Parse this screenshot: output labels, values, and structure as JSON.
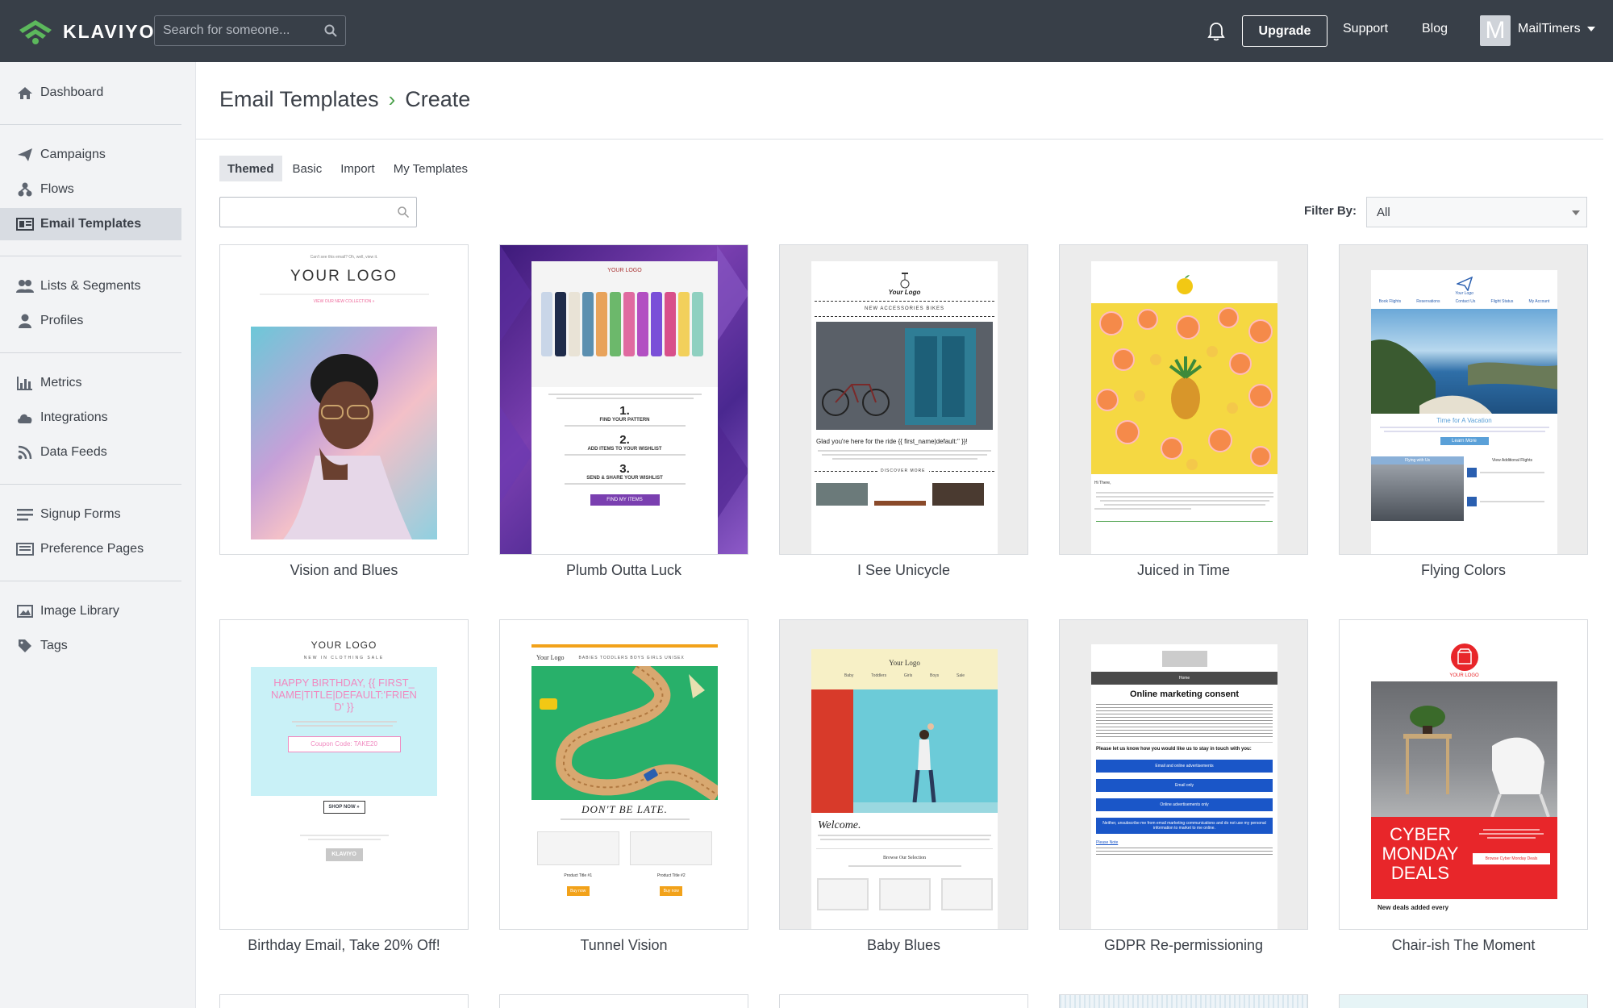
{
  "brand": {
    "name": "KLAVIYO",
    "accent": "#4aa04a",
    "topbar_bg": "#383f48"
  },
  "topbar": {
    "search_placeholder": "Search for someone...",
    "upgrade": "Upgrade",
    "support": "Support",
    "blog": "Blog",
    "avatar_letter": "M",
    "account": "MailTimers"
  },
  "sidebar": {
    "items": [
      {
        "label": "Dashboard",
        "icon": "home-icon"
      },
      {
        "label": "Campaigns",
        "icon": "paper-plane-icon"
      },
      {
        "label": "Flows",
        "icon": "flows-icon"
      },
      {
        "label": "Email Templates",
        "icon": "template-icon",
        "active": true
      },
      {
        "label": "Lists & Segments",
        "icon": "users-icon"
      },
      {
        "label": "Profiles",
        "icon": "user-icon"
      },
      {
        "label": "Metrics",
        "icon": "bar-chart-icon"
      },
      {
        "label": "Integrations",
        "icon": "cloud-icon"
      },
      {
        "label": "Data Feeds",
        "icon": "rss-icon"
      },
      {
        "label": "Signup Forms",
        "icon": "form-icon"
      },
      {
        "label": "Preference Pages",
        "icon": "page-icon"
      },
      {
        "label": "Image Library",
        "icon": "image-icon"
      },
      {
        "label": "Tags",
        "icon": "tag-icon"
      }
    ]
  },
  "breadcrumb": {
    "parent": "Email Templates",
    "current": "Create"
  },
  "tabs": [
    "Themed",
    "Basic",
    "Import",
    "My Templates"
  ],
  "filter": {
    "label": "Filter By:",
    "value": "All"
  },
  "templates": [
    {
      "title": "Vision and Blues",
      "header": "YOUR LOGO",
      "sub": "VIEW OUR NEW COLLECTION »",
      "top": "Can't see this email? Oh, well, view it."
    },
    {
      "title": "Plumb Outta Luck",
      "header": "YOUR LOGO",
      "step1": "FIND YOUR PATTERN",
      "step2": "ADD ITEMS TO YOUR WISHLIST",
      "step3": "SEND & SHARE YOUR WISHLIST",
      "cta": "FIND MY ITEMS",
      "n1": "1.",
      "n2": "2.",
      "n3": "3."
    },
    {
      "title": "I See Unicycle",
      "header": "Your Logo",
      "nav": "NEW    ACCESSORIES    BIKES",
      "greet": "Glad you're here for the ride {{ first_name|default:'' }}!",
      "more": "DISCOVER MORE"
    },
    {
      "title": "Juiced in Time",
      "greet": "Hi There,"
    },
    {
      "title": "Flying Colors",
      "header": "Your Logo",
      "nav": [
        "Book Flights",
        "Reservations",
        "Contact Us",
        "Flight Status",
        "My Account"
      ],
      "heading": "Time for A Vacation",
      "cta": "Learn More",
      "left": "Flying with Us",
      "right": "View Additional Flights"
    },
    {
      "title": "Birthday Email, Take 20% Off!",
      "header": "YOUR LOGO",
      "nav": "NEW IN    CLOTHING    SALE",
      "headline": "HAPPY BIRTHDAY, {{ FIRST_NAME|TITLE|DEFAULT:'FRIEND' }}",
      "coupon": "Coupon Code: TAKE20",
      "cta": "SHOP NOW »",
      "footer_logo": "KLAVIYO"
    },
    {
      "title": "Tunnel Vision",
      "header": "Your Logo",
      "nav": "BABIES   TODDLERS   BOYS   GIRLS   UNISEX",
      "headline": "DON'T BE LATE.",
      "p1": "Product Title #1",
      "p2": "Product Title #2",
      "buy": "Buy now"
    },
    {
      "title": "Baby Blues",
      "header": "Your Logo",
      "nav": [
        "Baby",
        "Toddlers",
        "Girls",
        "Boys",
        "Sale"
      ],
      "headline": "Welcome.",
      "browse": "Browse Our Selection"
    },
    {
      "title": "GDPR Re-permissioning",
      "home": "Home",
      "headline": "Online marketing consent",
      "ask": "Please let us know how you would like us to stay in touch with you:",
      "opt1": "Email and online advertisements",
      "opt2": "Email only",
      "opt3": "Online advertisements only",
      "opt4": "Neither, unsubscribe me from email marketing communications and do not use my personal information to market to me online.",
      "note": "Please Note"
    },
    {
      "title": "Chair-ish The Moment",
      "header": "YOUR LOGO",
      "headline": "CYBER MONDAY DEALS",
      "cta": "Browse Cyber Monday Deals",
      "footer": "New deals added every"
    }
  ]
}
